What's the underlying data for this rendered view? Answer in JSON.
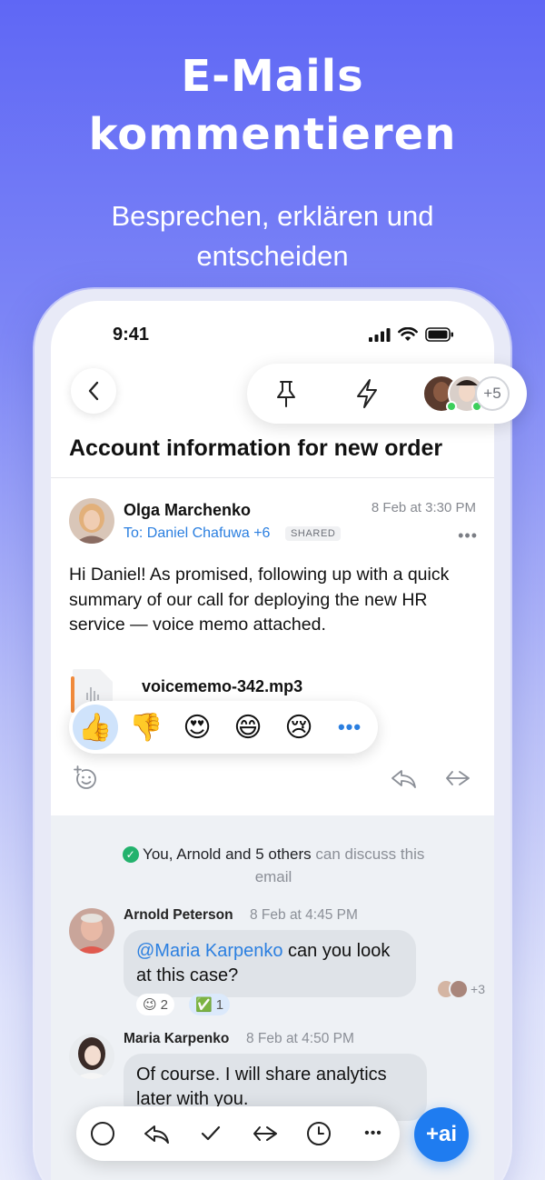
{
  "promo": {
    "headline_line1": "E-Mails",
    "headline_line2": "kommentieren",
    "subline_line1": "Besprechen, erklären und",
    "subline_line2": "entscheiden"
  },
  "status_bar": {
    "time": "9:41"
  },
  "header": {
    "pin_icon": "pin-icon",
    "bolt_icon": "lightning-icon",
    "participants_more": "+5"
  },
  "email": {
    "subject": "Account information for new order",
    "sender": "Olga Marchenko",
    "recipients": "To: Daniel Chafuwa +6",
    "shared_badge": "SHARED",
    "date": "8 Feb at 3:30 PM",
    "body": "Hi Daniel! As promised, following up with a quick summary of our call for deploying the new HR service — voice memo attached.",
    "attachment_name": "voicememo-342.mp3"
  },
  "reactions": [
    "👍",
    "👎",
    "😍",
    "😄",
    "😢"
  ],
  "reaction_more": "•••",
  "discussion": {
    "note_main": "You, Arnold and 5 others",
    "note_muted": "can discuss this email",
    "comments": [
      {
        "author": "Arnold Peterson",
        "date": "8 Feb at 4:45 PM",
        "mention": "@Maria Karpenko",
        "text": " can you look at this case?",
        "reactions": [
          {
            "emoji": "😉",
            "count": "2"
          },
          {
            "emoji": "✅",
            "count": "1"
          }
        ],
        "seen_more": "+3"
      },
      {
        "author": "Maria Karpenko",
        "date": "8 Feb at 4:50 PM",
        "text": "Of course. I will share analytics later with you."
      }
    ]
  },
  "toolbar": {
    "ai_label": "+ai"
  },
  "colors": {
    "accent": "#1f7cf0",
    "background_top": "#5f67f5",
    "bubble": "#dfe3e8"
  }
}
